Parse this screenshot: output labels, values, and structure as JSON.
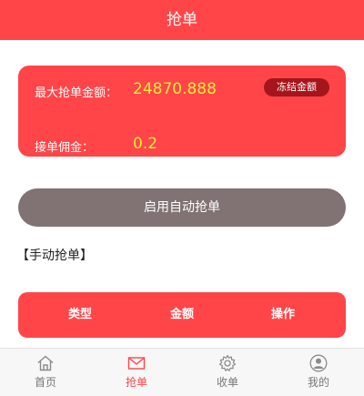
{
  "header": {
    "title": "抢单"
  },
  "summary": {
    "max_amount_label": "最大抢单金额：",
    "max_amount_value": "24870.888",
    "commission_label": "接单佣金：",
    "commission_value": "0.2",
    "freeze_button_label": "冻结金额"
  },
  "auto_grab_button_label": "启用自动抢单",
  "manual_section_title": "【手动抢单】",
  "table": {
    "columns": [
      "类型",
      "金额",
      "操作"
    ]
  },
  "tabbar": {
    "items": [
      {
        "label": "首页",
        "icon": "home-icon"
      },
      {
        "label": "抢单",
        "icon": "mail-icon",
        "active": true
      },
      {
        "label": "收单",
        "icon": "gear-icon"
      },
      {
        "label": "我的",
        "icon": "user-icon"
      }
    ]
  },
  "colors": {
    "primary": "#ff4548",
    "value_yellow": "#ffec3d",
    "freeze_button": "#a4161c",
    "auto_button": "#817373"
  }
}
